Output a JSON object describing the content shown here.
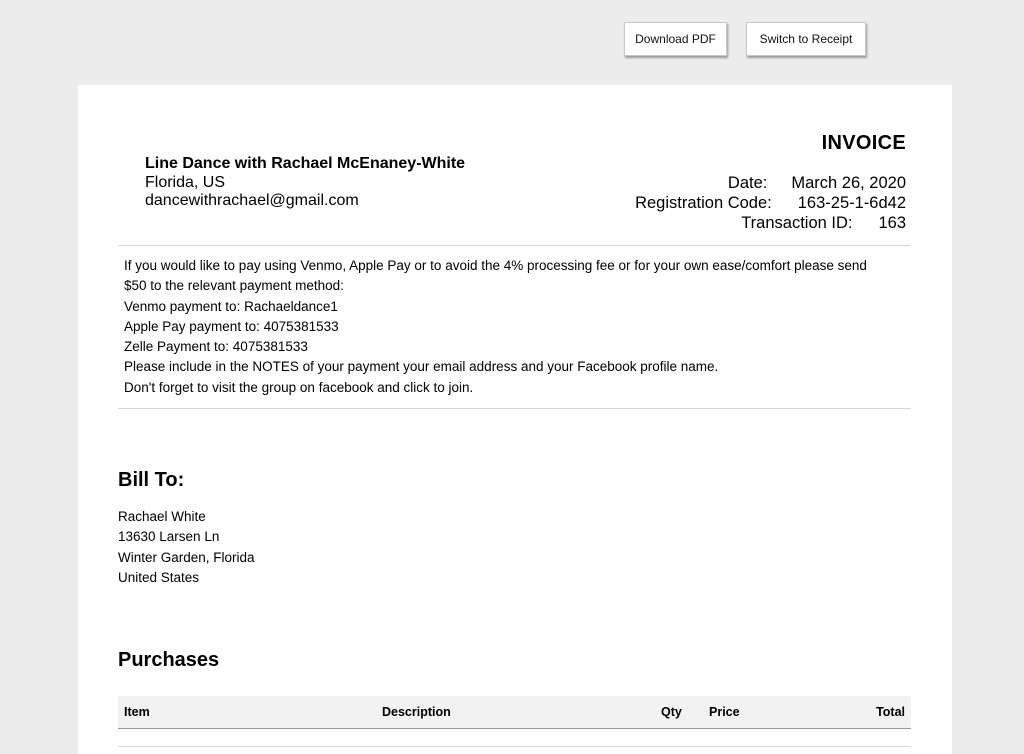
{
  "toolbar": {
    "download_pdf_label": "Download PDF",
    "switch_receipt_label": "Switch to Receipt"
  },
  "seller": {
    "name": "Line Dance with Rachael McEnaney-White",
    "location": "Florida, US",
    "email": "dancewithrachael@gmail.com"
  },
  "invoice": {
    "title": "INVOICE",
    "date_label": "Date:",
    "date_value": "March 26, 2020",
    "registration_label": "Registration Code:",
    "registration_value": "163-25-1-6d42",
    "transaction_label": "Transaction ID:",
    "transaction_value": "163"
  },
  "notes": [
    "If you would like to pay using Venmo, Apple Pay or to avoid the 4% processing fee or for your own ease/comfort please send",
    "$50 to the relevant payment method:",
    "Venmo payment to: Rachaeldance1",
    "Apple Pay payment to: 4075381533",
    "Zelle Payment to: 4075381533",
    "Please include in the NOTES of your payment your email address and your Facebook profile name.",
    "Don't forget to visit the group on facebook and click to join."
  ],
  "bill_to": {
    "heading": "Bill To:",
    "name": "Rachael White",
    "street": "13630 Larsen Ln",
    "city": "Winter Garden, Florida",
    "country": "United States"
  },
  "purchases": {
    "heading": "Purchases",
    "columns": {
      "item": "Item",
      "description": "Description",
      "qty": "Qty",
      "price": "Price",
      "total": "Total"
    }
  }
}
